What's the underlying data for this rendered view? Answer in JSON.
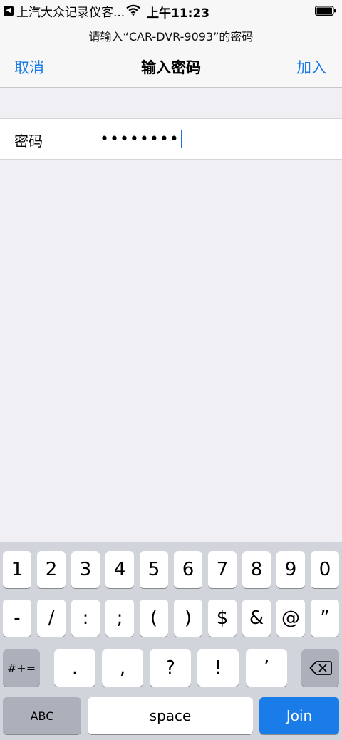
{
  "status_bar": {
    "back_chip_glyph": "◀",
    "back_label": "上汽大众记录仪客...",
    "time": "上午11:23"
  },
  "nav": {
    "prompt": "请输入“CAR-DVR-9093”的密码",
    "cancel": "取消",
    "title": "输入密码",
    "join": "加入"
  },
  "password": {
    "label": "密码",
    "masked_value": "••••••••"
  },
  "keyboard": {
    "row1": [
      "1",
      "2",
      "3",
      "4",
      "5",
      "6",
      "7",
      "8",
      "9",
      "0"
    ],
    "row2": [
      "-",
      "/",
      ":",
      ";",
      "(",
      ")",
      "$",
      "&",
      "@",
      "”"
    ],
    "row3_mode": "#+=",
    "row3": [
      ".",
      ",",
      "?",
      "!",
      "’"
    ],
    "abc": "ABC",
    "space": "space",
    "join": "Join"
  },
  "colors": {
    "accent": "#1a7ce8",
    "caret": "#1e6fe0",
    "keyboard_bg": "#d1d4db"
  }
}
